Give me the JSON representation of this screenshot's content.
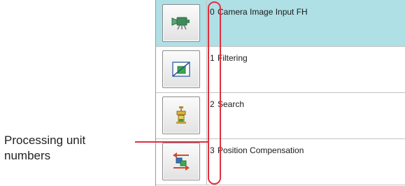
{
  "callout": {
    "label": "Processing unit numbers"
  },
  "colors": {
    "selected_row": "#aee0e6",
    "annotation": "#e0303e"
  },
  "flow": {
    "items": [
      {
        "number": "0",
        "name": "Camera Image Input FH",
        "icon": "camera-image-input-icon",
        "selected": true
      },
      {
        "number": "1",
        "name": "Filtering",
        "icon": "filtering-icon",
        "selected": false
      },
      {
        "number": "2",
        "name": "Search",
        "icon": "search-icon",
        "selected": false
      },
      {
        "number": "3",
        "name": "Position Compensation",
        "icon": "position-compensation-icon",
        "selected": false
      }
    ]
  }
}
